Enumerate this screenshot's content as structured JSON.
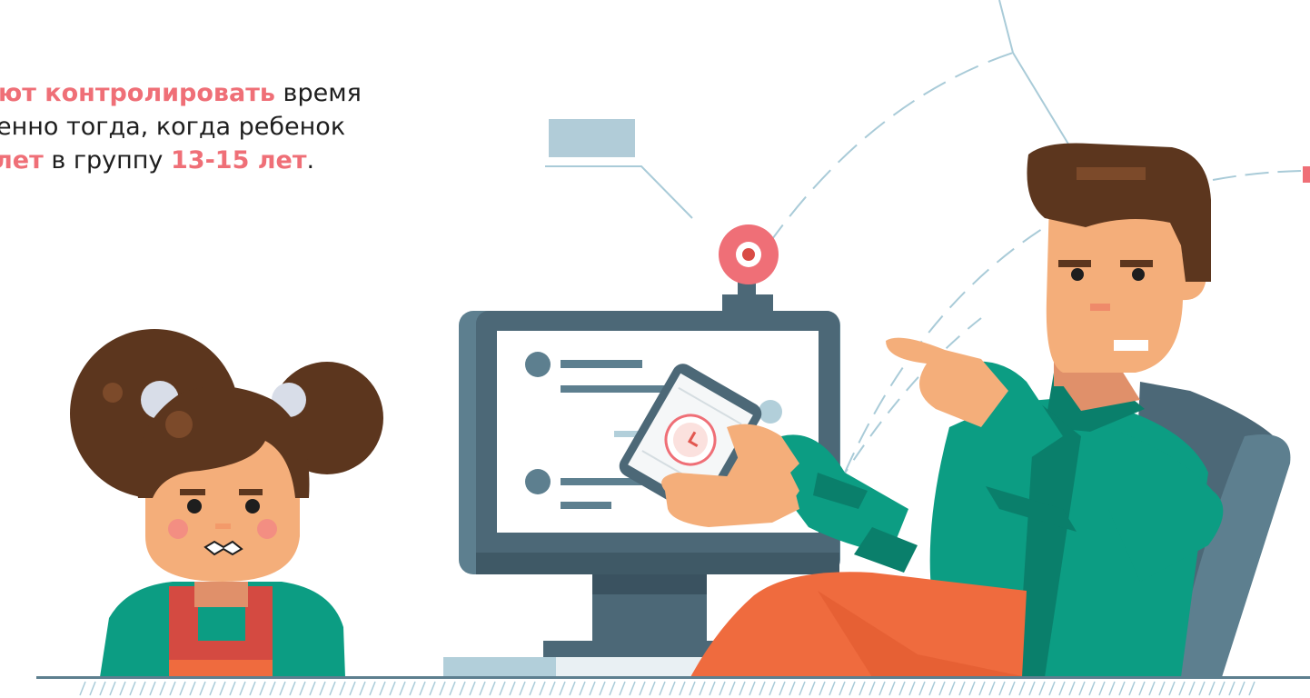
{
  "caption": {
    "line1": {
      "accent": "ют контролировать",
      "rest": " время"
    },
    "line2": {
      "text": "енно тогда, когда ребенок"
    },
    "line3": {
      "accent1": "лет",
      "middle": " в группу ",
      "accent2": "13-15 лет",
      "end": "."
    }
  },
  "fragments": {
    "comma": ",",
    "period": "."
  },
  "colors": {
    "accent": "#ef6f77",
    "hair": "#5c361e",
    "skin": "#f4ae7a",
    "teal": "#0c9d83",
    "orange": "#ef6b3e",
    "monitor": "#4c6877",
    "sky": "#b2cfda"
  }
}
